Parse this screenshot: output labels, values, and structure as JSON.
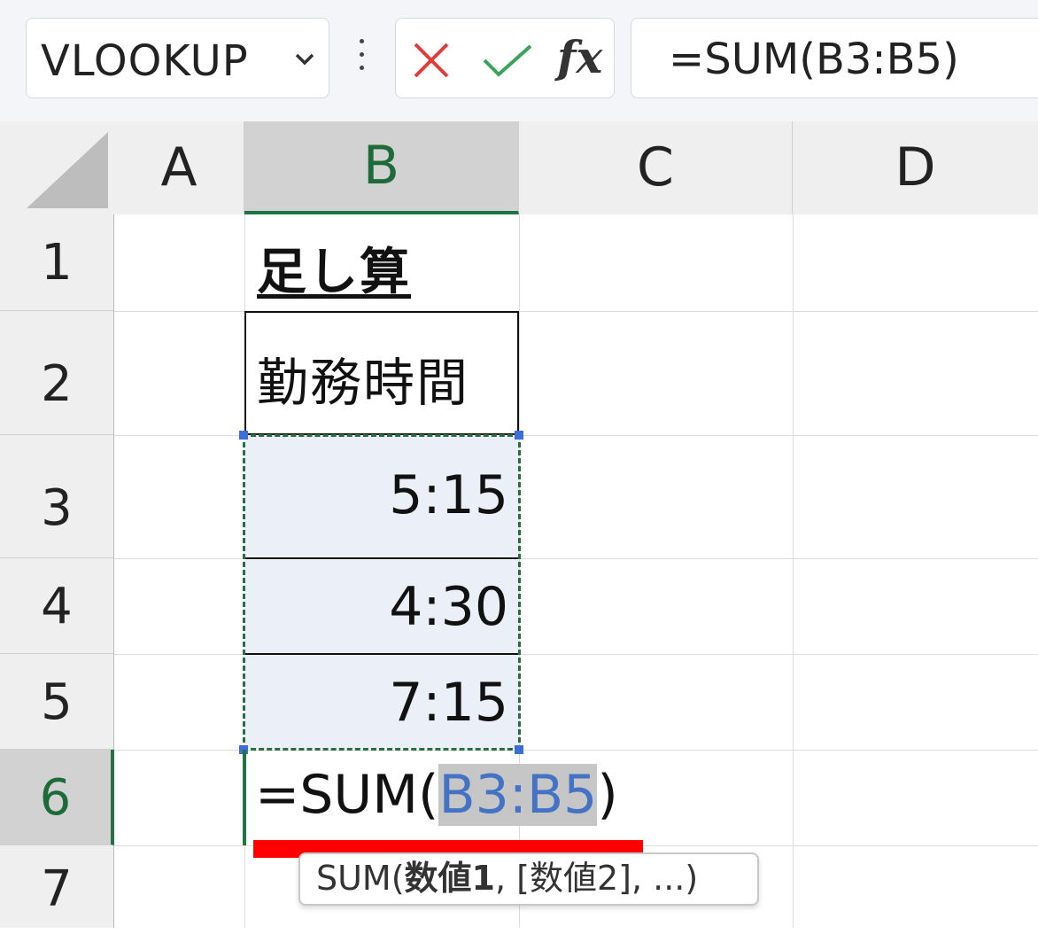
{
  "formula_bar": {
    "name_box": "VLOOKUP",
    "fx_label": "fx",
    "formula": "=SUM(B3:B5)"
  },
  "columns": [
    "A",
    "B",
    "C",
    "D"
  ],
  "rows": [
    "1",
    "2",
    "3",
    "4",
    "5",
    "6",
    "7"
  ],
  "cells": {
    "B1": "足し算",
    "B2": "勤務時間",
    "B3": "5:15",
    "B4": "4:30",
    "B5": "7:15"
  },
  "edit": {
    "prefix": "=SUM(",
    "ref": "B3:B5",
    "suffix": ")"
  },
  "tooltip": {
    "func": "SUM(",
    "arg1": "数値1",
    "rest": ", [数値2], ...)"
  },
  "colors": {
    "selection_green": "#217346",
    "range_fill": "#eaeff8",
    "reference_blue": "#4472c4",
    "annotation_red": "#ff0000",
    "cancel_red": "#e03c3c",
    "enter_green": "#3aa35a"
  },
  "icons": [
    "chevron-down-icon",
    "more-options-icon",
    "cancel-icon",
    "enter-icon",
    "insert-function-icon"
  ]
}
